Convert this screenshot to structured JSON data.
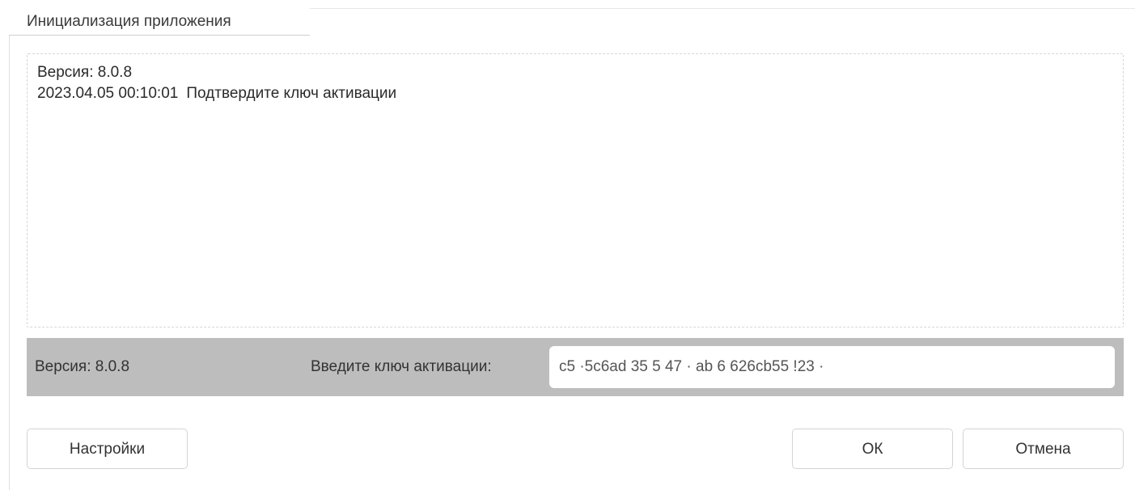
{
  "window": {
    "title": "Инициализация приложения"
  },
  "log": {
    "version_line": "Версия: 8.0.8",
    "entries": [
      {
        "time": "2023.04.05 00:10:01",
        "message": "Подтвердите ключ активации"
      }
    ]
  },
  "status_bar": {
    "version": "Версия: 8.0.8",
    "key_label": "Введите ключ активации:",
    "key_value": "c5 ·5c6ad 35 5 47 · ab 6 626cb55 !23 ·"
  },
  "buttons": {
    "settings": "Настройки",
    "ok": "ОК",
    "cancel": "Отмена"
  }
}
